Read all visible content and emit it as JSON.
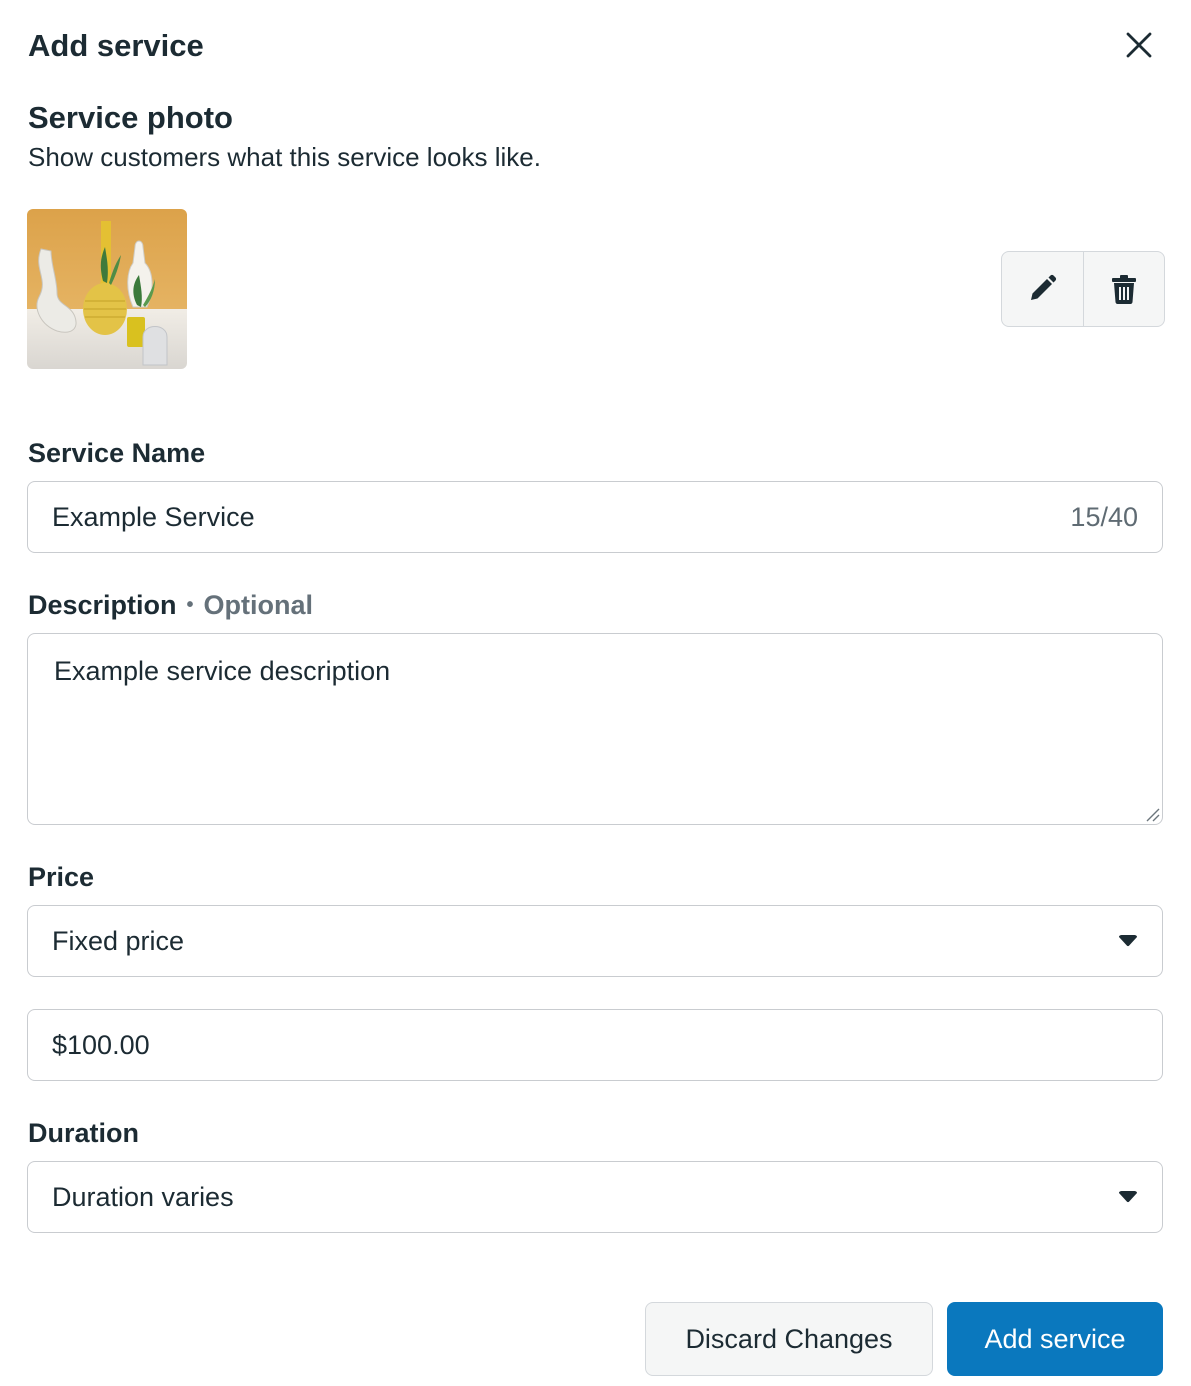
{
  "dialog": {
    "title": "Add service"
  },
  "photo_section": {
    "title": "Service photo",
    "subtitle": "Show customers what this service looks like."
  },
  "service_name": {
    "label": "Service Name",
    "value": "Example Service",
    "counter": "15/40"
  },
  "description": {
    "label": "Description",
    "optional": "Optional",
    "value": "Example service description"
  },
  "price": {
    "label": "Price",
    "type_value": "Fixed price",
    "amount": "$100.00"
  },
  "duration": {
    "label": "Duration",
    "value": "Duration varies"
  },
  "footer": {
    "discard_label": "Discard Changes",
    "submit_label": "Add service"
  },
  "colors": {
    "primary": "#0a78be",
    "text": "#1c2b33",
    "muted": "#65717a",
    "border": "#c9ccd0"
  },
  "icons": [
    "close-icon",
    "pencil-icon",
    "trash-icon",
    "caret-down-icon",
    "resize-handle-icon"
  ]
}
